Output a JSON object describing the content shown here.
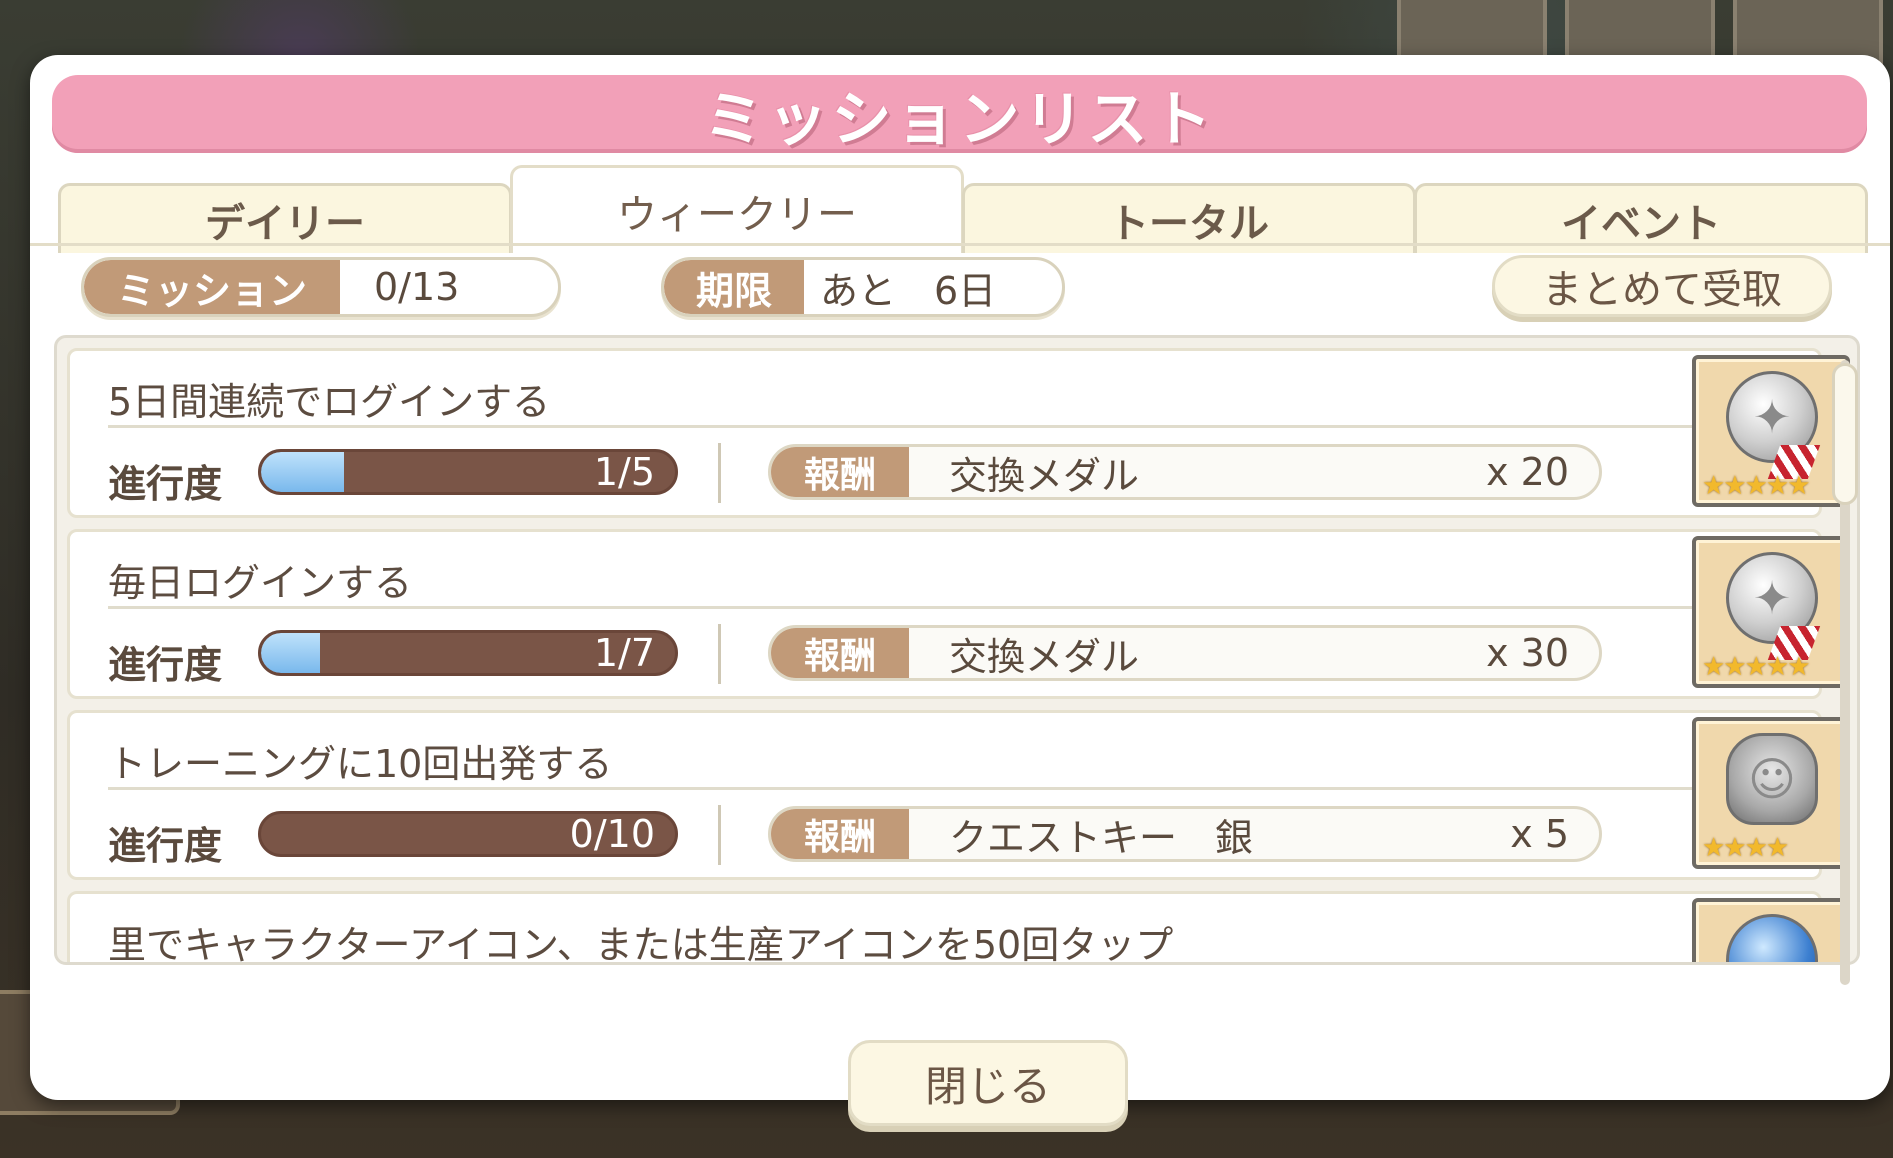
{
  "title": "ミッションリスト",
  "tabs": [
    {
      "label": "デイリー",
      "active": false
    },
    {
      "label": "ウィークリー",
      "active": true
    },
    {
      "label": "トータル",
      "active": false
    },
    {
      "label": "イベント",
      "active": false
    }
  ],
  "stats": {
    "mission_label": "ミッション",
    "mission_value": "0/13",
    "deadline_label": "期限",
    "deadline_value": "あと　6日"
  },
  "claim_all_label": "まとめて受取",
  "progress_label": "進行度",
  "reward_label": "報酬",
  "missions": [
    {
      "title": "5日間連続でログインする",
      "progress_text": "1/5",
      "progress_fraction": 0.2,
      "reward_name": "交換メダル",
      "reward_qty": "x 20",
      "icon": "silver-medal-icon",
      "stars": "★★★★★"
    },
    {
      "title": "毎日ログインする",
      "progress_text": "1/7",
      "progress_fraction": 0.143,
      "reward_name": "交換メダル",
      "reward_qty": "x 30",
      "icon": "silver-medal-icon",
      "stars": "★★★★★"
    },
    {
      "title": "トレーニングに10回出発する",
      "progress_text": "0/10",
      "progress_fraction": 0.0,
      "reward_name": "クエストキー　銀",
      "reward_qty": "x 5",
      "icon": "silver-quest-key-icon",
      "stars": "★★★★"
    },
    {
      "title": "里でキャラクターアイコン、または生産アイコンを50回タップ",
      "icon": "blue-orb-icon"
    }
  ],
  "close_label": "閉じる",
  "colors": {
    "title_bar": "#f2a0b8",
    "label_brown": "#c19a78",
    "progress_bar": "#7a5547",
    "progress_fill": "#79b8ec",
    "star": "#f2b92c"
  }
}
